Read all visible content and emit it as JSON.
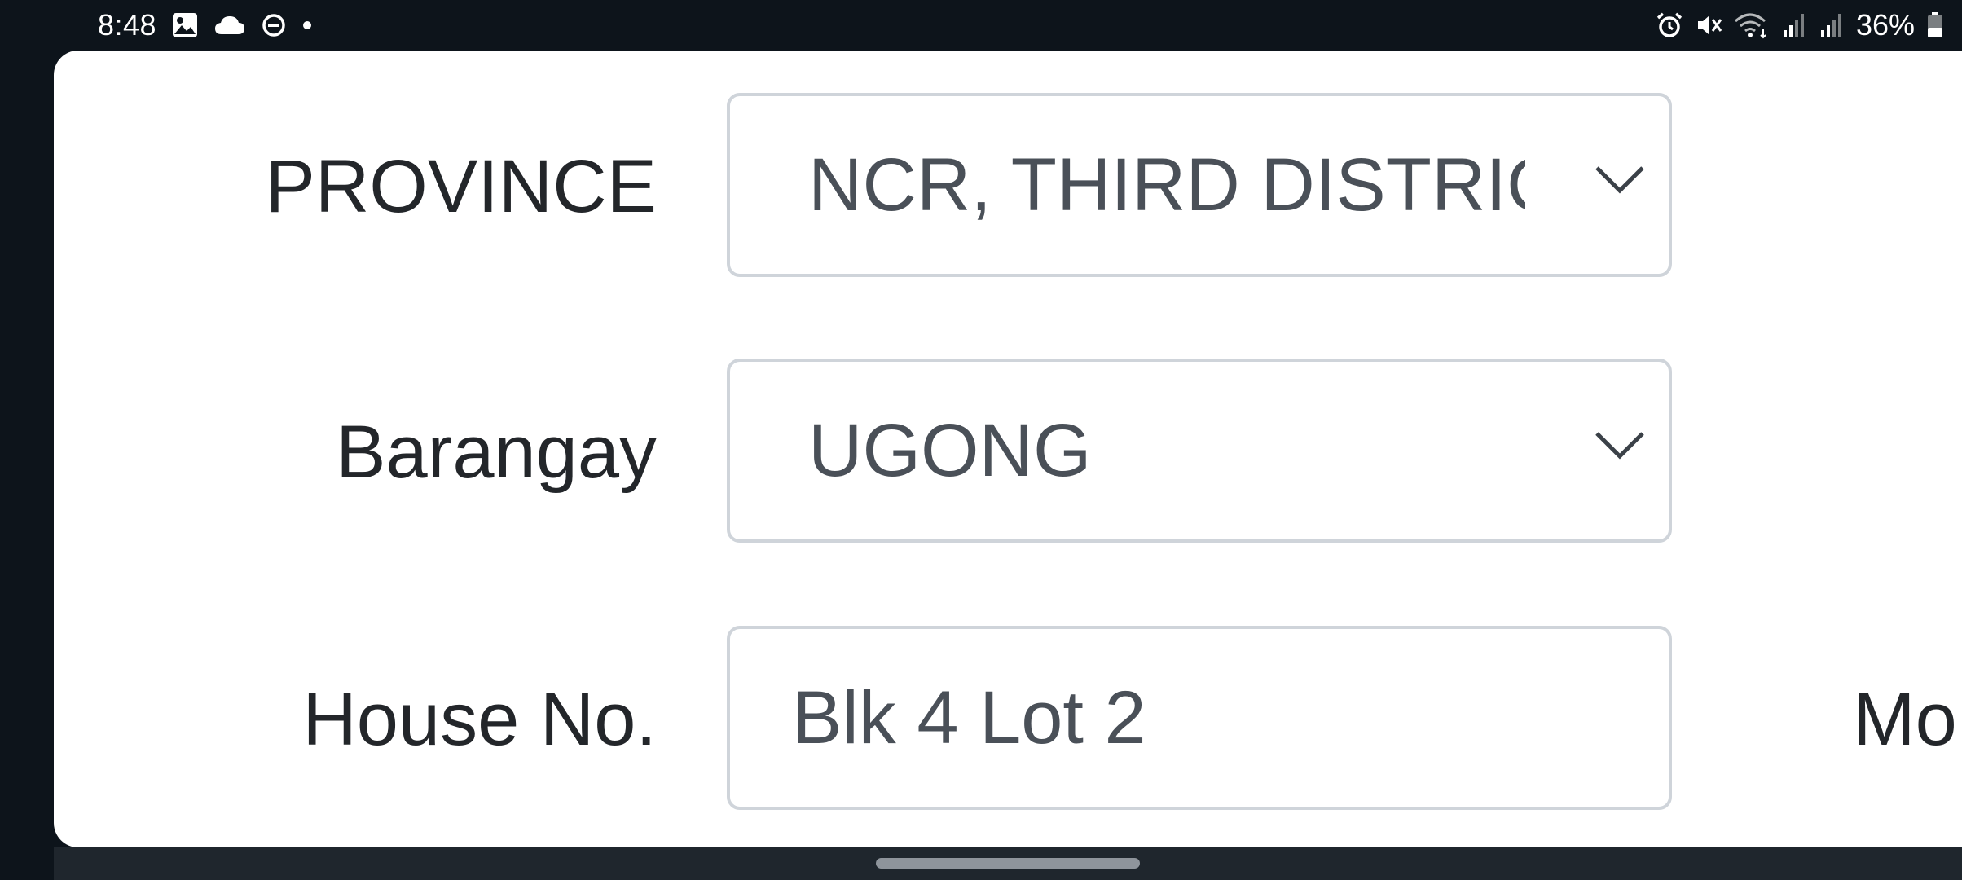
{
  "status_bar": {
    "time": "8:48",
    "left_icons": [
      "image-icon",
      "cloud-icon",
      "do-not-disturb-icon",
      "dot-icon"
    ],
    "right_icons": [
      "alarm-icon",
      "mute-icon",
      "wifi-icon",
      "signal-icon",
      "signal-icon"
    ],
    "battery_percent": "36%",
    "battery_level": 0.36
  },
  "form": {
    "province": {
      "label": "PROVINCE",
      "value": "NCR, THIRD DISTRIC",
      "icon": "chevron-down-icon"
    },
    "barangay": {
      "label": "Barangay",
      "value": "UGONG",
      "icon": "chevron-down-icon"
    },
    "house_no": {
      "label": "House No.",
      "value": "Blk 4 Lot 2"
    },
    "next_label_partial": "Mo"
  },
  "colors": {
    "label_text": "#23262a",
    "value_text": "#4a5058",
    "border": "#cfd4da",
    "background": "#ffffff",
    "status_bar": "#0d141b"
  }
}
